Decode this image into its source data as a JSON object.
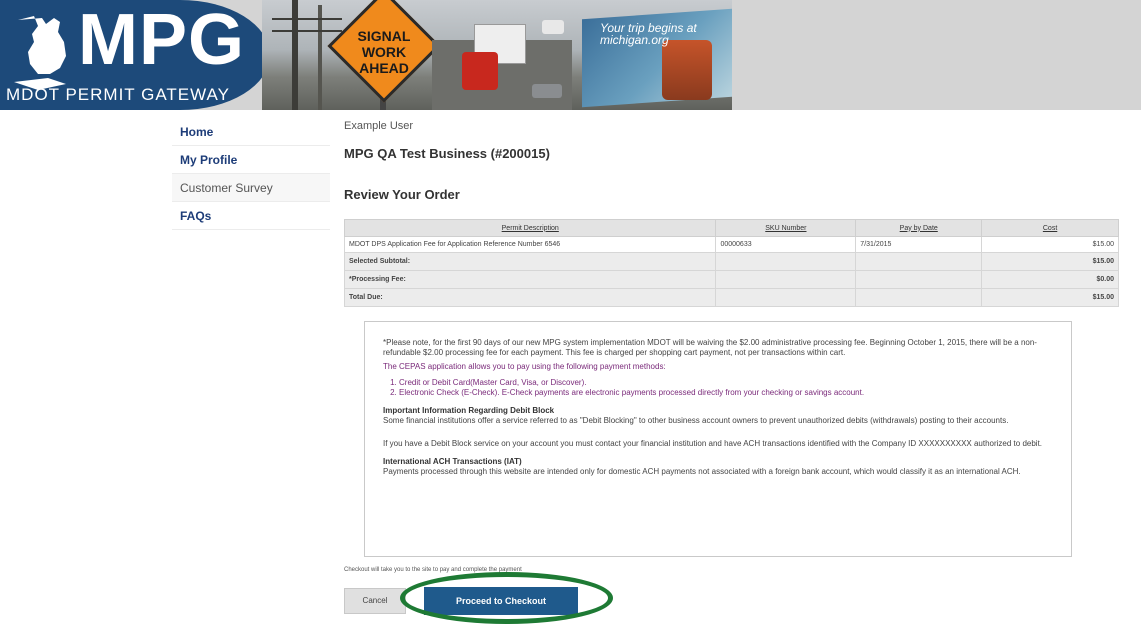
{
  "banner": {
    "brand_title": "MPG",
    "brand_subtitle": "MDOT PERMIT GATEWAY",
    "sign_line1": "SIGNAL",
    "sign_line2": "WORK",
    "sign_line3": "AHEAD",
    "billboard_text": "Your trip begins at michigan.org"
  },
  "sidebar": {
    "items": [
      {
        "label": "Home"
      },
      {
        "label": "My Profile"
      },
      {
        "label": "Customer Survey"
      },
      {
        "label": "FAQs"
      }
    ]
  },
  "main": {
    "user_name": "Example User",
    "business": "MPG QA Test Business (#200015)",
    "section_title": "Review Your Order"
  },
  "table": {
    "headers": [
      "Permit Description",
      "SKU Number",
      "Pay by Date",
      "Cost"
    ],
    "row": {
      "description": "MDOT DPS Application Fee for Application Reference Number 6546",
      "sku": "00000633",
      "pay_by": "7/31/2015",
      "cost": "$15.00"
    },
    "subtotal_label": "Selected Subtotal:",
    "subtotal_value": "$15.00",
    "fee_label": "*Processing Fee:",
    "fee_value": "$0.00",
    "total_label": "Total Due:",
    "total_value": "$15.00"
  },
  "notice": {
    "p1": "*Please note, for the first 90 days of our new MPG system implementation MDOT will be waiving the $2.00 administrative processing fee. Beginning October 1, 2015, there will be a non-refundable $2.00 processing fee for each payment. This fee is charged per shopping cart payment, not per transactions within cart.",
    "p2": "The CEPAS application allows you to pay using the following payment methods:",
    "m1": "Credit or Debit Card(Master Card, Visa, or Discover).",
    "m2": "Electronic Check (E-Check). E-Check payments are electronic payments processed directly from your checking or savings account.",
    "h1": "Important Information Regarding Debit Block",
    "t1": "Some financial institutions offer a service referred to as \"Debit Blocking\" to other business account owners to prevent unauthorized debits (withdrawals) posting to their accounts.",
    "t2": "If you have a Debit Block service on your account you must contact your financial institution and have ACH transactions identified with the Company ID XXXXXXXXXX authorized to debit.",
    "h2": "International ACH Transactions (IAT)",
    "t3": "Payments processed through this website are intended only for domestic ACH payments not associated with a foreign bank account, which would classify it as an international ACH."
  },
  "footer": {
    "checkout_note": "Checkout will take you to the site to pay and complete the payment",
    "cancel_label": "Cancel",
    "proceed_label": "Proceed to Checkout"
  },
  "colors": {
    "brand": "#1d4a7a",
    "nav_link": "#1d3c78",
    "proceed": "#1f5a8c",
    "highlight": "#1e7a34"
  }
}
